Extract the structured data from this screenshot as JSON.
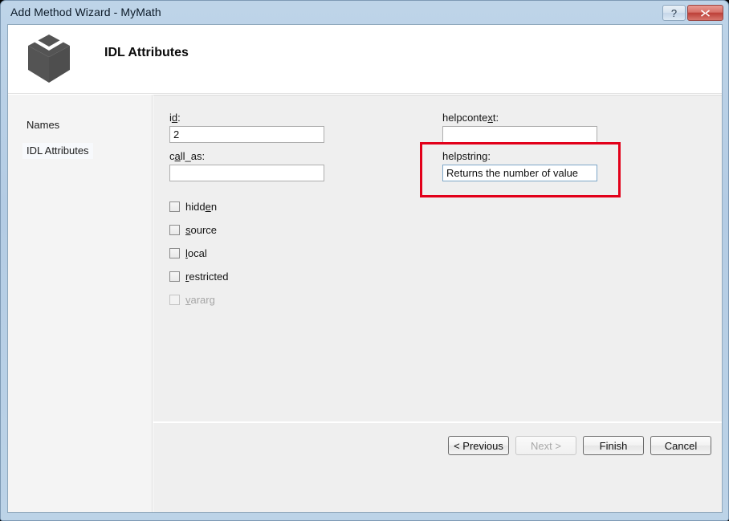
{
  "window": {
    "title": "Add Method Wizard - MyMath",
    "help_button": "?",
    "close_button": "close-x"
  },
  "header": {
    "title": "IDL Attributes",
    "icon": "cube-box-icon"
  },
  "sidebar": {
    "items": [
      {
        "label": "Names",
        "selected": false
      },
      {
        "label": "IDL Attributes",
        "selected": true
      }
    ]
  },
  "form": {
    "id": {
      "label_pre": "i",
      "label_accel": "d",
      "label_post": ":",
      "value": "2",
      "placeholder": ""
    },
    "call_as": {
      "label_pre": "c",
      "label_accel": "a",
      "label_post": "ll_as:",
      "value": "",
      "placeholder": ""
    },
    "helpcontext": {
      "label_pre": "helpconte",
      "label_accel": "x",
      "label_post": "t:",
      "value": "",
      "placeholder": ""
    },
    "helpstring": {
      "label_pre": "helpstrin",
      "label_accel": "g",
      "label_post": ":",
      "value": "Returns the number of value",
      "placeholder": ""
    }
  },
  "checkboxes": [
    {
      "pre": "hidd",
      "accel": "e",
      "post": "n",
      "checked": false,
      "disabled": false
    },
    {
      "pre": "",
      "accel": "s",
      "post": "ource",
      "checked": false,
      "disabled": false
    },
    {
      "pre": "",
      "accel": "l",
      "post": "ocal",
      "checked": false,
      "disabled": false
    },
    {
      "pre": "",
      "accel": "r",
      "post": "estricted",
      "checked": false,
      "disabled": false
    },
    {
      "pre": "",
      "accel": "v",
      "post": "ararg",
      "checked": false,
      "disabled": true
    }
  ],
  "annotation": {
    "color": "#e2001a",
    "target": "helpstring"
  },
  "footer": {
    "previous": "< Previous",
    "next": "Next >",
    "finish": "Finish",
    "cancel": "Cancel",
    "next_disabled": true
  }
}
